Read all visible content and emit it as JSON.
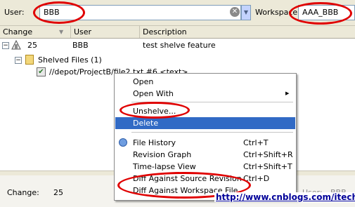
{
  "filter": {
    "user_label": "User:",
    "user_value": "BBB",
    "workspace_label": "Workspace:",
    "workspace_value": "AAA_BBB"
  },
  "columns": [
    "Change",
    "User",
    "Description"
  ],
  "tree": {
    "change": {
      "number": "25",
      "user": "BBB",
      "description": "test shelve feature"
    },
    "shelved_label": "Shelved Files (1)",
    "file_label": "//depot/ProjectB/file2.txt #6 <text>"
  },
  "context_menu": {
    "items": [
      {
        "label": "Open",
        "shortcut": ""
      },
      {
        "label": "Open With",
        "shortcut": ""
      },
      {
        "label": "Unshelve...",
        "shortcut": ""
      },
      {
        "label": "Delete",
        "shortcut": ""
      },
      {
        "label": "File History",
        "shortcut": "Ctrl+T"
      },
      {
        "label": "Revision Graph",
        "shortcut": "Ctrl+Shift+R"
      },
      {
        "label": "Time-lapse View",
        "shortcut": "Ctrl+Shift+T"
      },
      {
        "label": "Diff Against Source Revision",
        "shortcut": "Ctrl+D"
      },
      {
        "label": "Diff Against Workspace File",
        "shortcut": ""
      }
    ]
  },
  "details": {
    "change_label": "Change:",
    "change_value": "25",
    "user_label": "User:",
    "user_value": "BBB"
  },
  "watermark": "http://www.cnblogs.com/itech/",
  "colors": {
    "annotation": "#e00000",
    "selection": "#316ac5"
  }
}
